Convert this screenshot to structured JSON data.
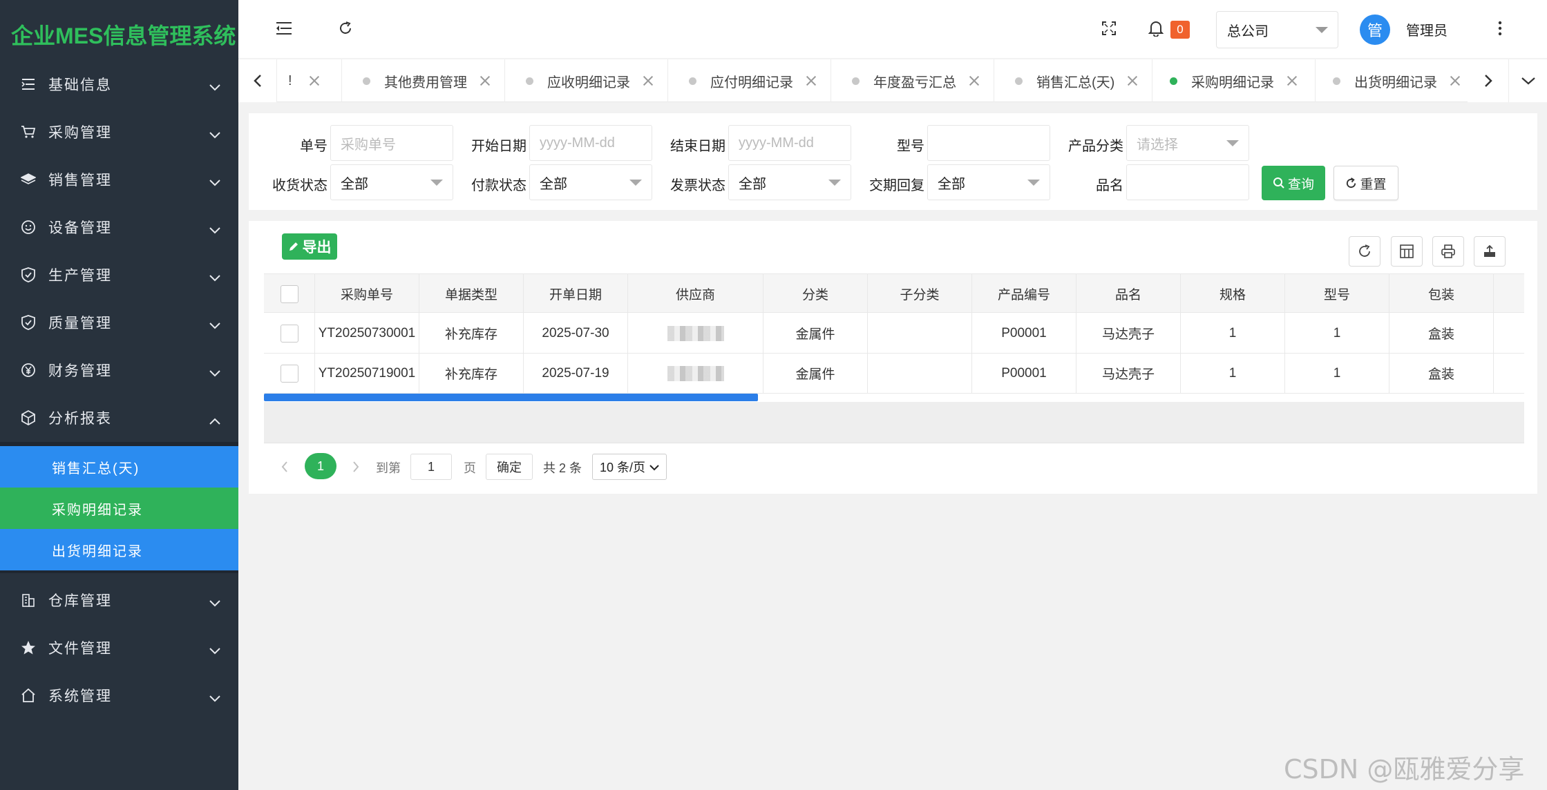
{
  "app": {
    "title": "企业MES信息管理系统"
  },
  "sidebar": {
    "items": [
      {
        "label": "基础信息",
        "icon": "list-icon"
      },
      {
        "label": "采购管理",
        "icon": "cart-icon"
      },
      {
        "label": "销售管理",
        "icon": "layers-icon"
      },
      {
        "label": "设备管理",
        "icon": "smile-icon"
      },
      {
        "label": "生产管理",
        "icon": "shield-icon"
      },
      {
        "label": "质量管理",
        "icon": "shield-check-icon"
      },
      {
        "label": "财务管理",
        "icon": "yen-icon"
      },
      {
        "label": "分析报表",
        "icon": "cube-icon"
      },
      {
        "label": "仓库管理",
        "icon": "building-icon"
      },
      {
        "label": "文件管理",
        "icon": "star-icon"
      },
      {
        "label": "系统管理",
        "icon": "home-icon"
      }
    ],
    "submenu": [
      {
        "label": "销售汇总(天)"
      },
      {
        "label": "采购明细记录"
      },
      {
        "label": "出货明细记录"
      }
    ]
  },
  "header": {
    "notifications": "0",
    "company": "总公司",
    "avatar_text": "管",
    "username": "管理员"
  },
  "tabs": [
    {
      "label": "!"
    },
    {
      "label": "其他费用管理"
    },
    {
      "label": "应收明细记录"
    },
    {
      "label": "应付明细记录"
    },
    {
      "label": "年度盈亏汇总"
    },
    {
      "label": "销售汇总(天)"
    },
    {
      "label": "采购明细记录",
      "active": true
    },
    {
      "label": "出货明细记录"
    }
  ],
  "filters": {
    "order_no": {
      "label": "单号",
      "placeholder": "采购单号"
    },
    "start_date": {
      "label": "开始日期",
      "placeholder": "yyyy-MM-dd"
    },
    "end_date": {
      "label": "结束日期",
      "placeholder": "yyyy-MM-dd"
    },
    "model": {
      "label": "型号",
      "value": ""
    },
    "category": {
      "label": "产品分类",
      "placeholder": "请选择"
    },
    "receive_status": {
      "label": "收货状态",
      "value": "全部"
    },
    "pay_status": {
      "label": "付款状态",
      "value": "全部"
    },
    "invoice_status": {
      "label": "发票状态",
      "value": "全部"
    },
    "delivery_reply": {
      "label": "交期回复",
      "value": "全部"
    },
    "product_name": {
      "label": "品名",
      "value": ""
    },
    "query_label": "查询",
    "reset_label": "重置"
  },
  "table": {
    "export_label": "导出",
    "columns": [
      "采购单号",
      "单据类型",
      "开单日期",
      "供应商",
      "分类",
      "子分类",
      "产品编号",
      "品名",
      "规格",
      "型号",
      "包装"
    ],
    "rows": [
      [
        "YT20250730001",
        "补充库存",
        "2025-07-30",
        "",
        "金属件",
        "",
        "P00001",
        "马达壳子",
        "1",
        "1",
        "盒装"
      ],
      [
        "YT20250719001",
        "补充库存",
        "2025-07-19",
        "",
        "金属件",
        "",
        "P00001",
        "马达壳子",
        "1",
        "1",
        "盒装"
      ]
    ]
  },
  "pager": {
    "current": "1",
    "goto_label": "到第",
    "goto_value": "1",
    "page_unit": "页",
    "confirm_label": "确定",
    "total": "共 2 条",
    "page_size": "10 条/页"
  },
  "watermark": "CSDN @瓯雅爱分享",
  "colors": {
    "accent_green": "#2fb25a",
    "accent_blue": "#2b8cf0",
    "sidebar_bg": "#28323d",
    "badge": "#f0622d"
  }
}
